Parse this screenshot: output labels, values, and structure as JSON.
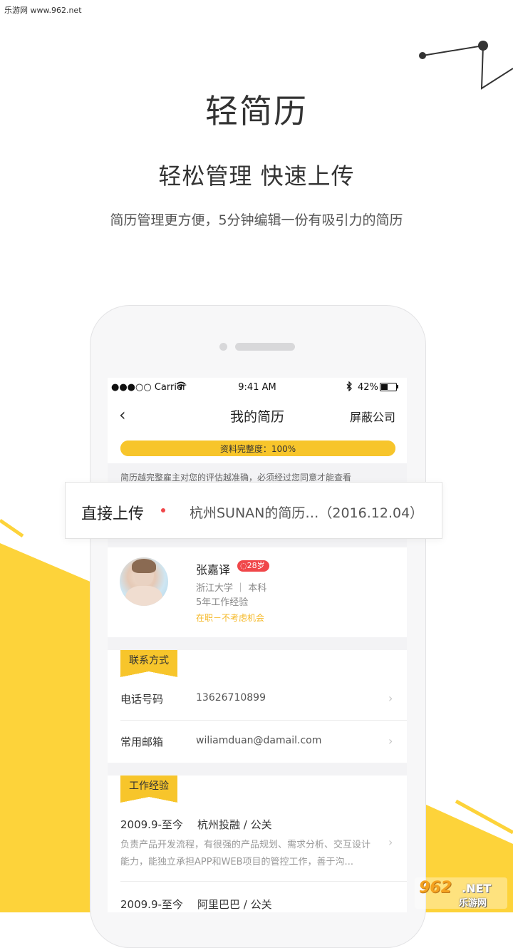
{
  "watermark_top": "乐游网 www.962.net",
  "hero": {
    "title": "轻简历",
    "subtitle": "轻松管理 快速上传",
    "description": "简历管理更方便，5分钟编辑一份有吸引力的简历"
  },
  "statusbar": {
    "carrier": "●●●○○ Carrier",
    "time": "9:41 AM",
    "battery": "42%"
  },
  "navbar": {
    "back_icon": "‹",
    "title": "我的简历",
    "right_action": "屏蔽公司"
  },
  "completeness": {
    "label": "资料完整度：100%",
    "percent": 100
  },
  "notice": "简历越完整雇主对您的评估越准确，必须经过您同意才能查看",
  "upload_popup": {
    "label": "直接上传",
    "file": "杭州SUNAN的简历…（2016.12.04）"
  },
  "profile": {
    "name": "张嘉译",
    "age": "28岁",
    "education": "浙江大学 ｜ 本科",
    "experience": "5年工作经验",
    "status": "在职－不考虑机会"
  },
  "contact": {
    "section_title": "联系方式",
    "rows": [
      {
        "label": "电话号码",
        "value": "13626710899"
      },
      {
        "label": "常用邮箱",
        "value": "wiliamduan@damail.com"
      }
    ]
  },
  "work": {
    "section_title": "工作经验",
    "jobs": [
      {
        "period": "2009.9-至今",
        "company": "杭州投融 / 公关",
        "desc": "负责产品开发流程，有很强的产品规划、需求分析、交互设计能力，能独立承担APP和WEB项目的管控工作，善于沟..."
      },
      {
        "period": "2009.9-至今",
        "company": "阿里巴巴 / 公关"
      }
    ]
  },
  "watermark_bottom": {
    "num": "962",
    "net": ".NET",
    "cn": "乐游网"
  },
  "colors": {
    "accent": "#f7c52b",
    "badge": "#f0474a",
    "status": "#f5b826"
  }
}
